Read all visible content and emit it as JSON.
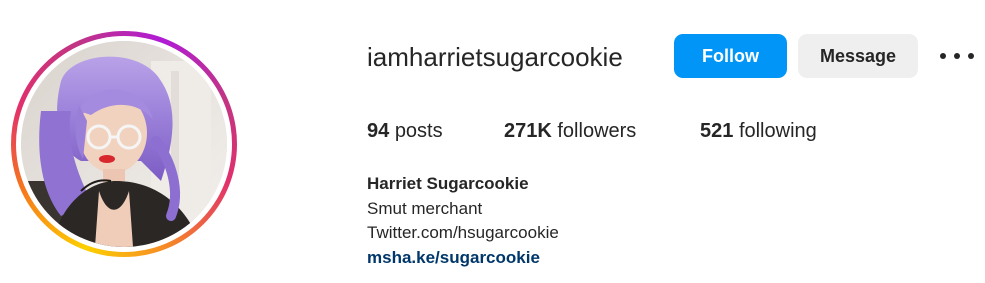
{
  "profile": {
    "username": "iamharrietsugarcookie",
    "follow_label": "Follow",
    "message_label": "Message",
    "more_icon": "more-horizontal-icon",
    "stats": {
      "posts_count": "94",
      "posts_label": "posts",
      "followers_count": "271K",
      "followers_label": "followers",
      "following_count": "521",
      "following_label": "following"
    },
    "bio": {
      "name": "Harriet Sugarcookie",
      "line1": "Smut merchant",
      "line2": "Twitter.com/hsugarcookie",
      "link": "msha.ke/sugarcookie"
    }
  },
  "colors": {
    "follow_button": "#0095f6",
    "message_button": "#efefef",
    "link": "#00376b",
    "text": "#262626",
    "story_ring": [
      "#fdd000",
      "#f7781b",
      "#e1306c",
      "#c13584",
      "#b01bd6"
    ]
  }
}
